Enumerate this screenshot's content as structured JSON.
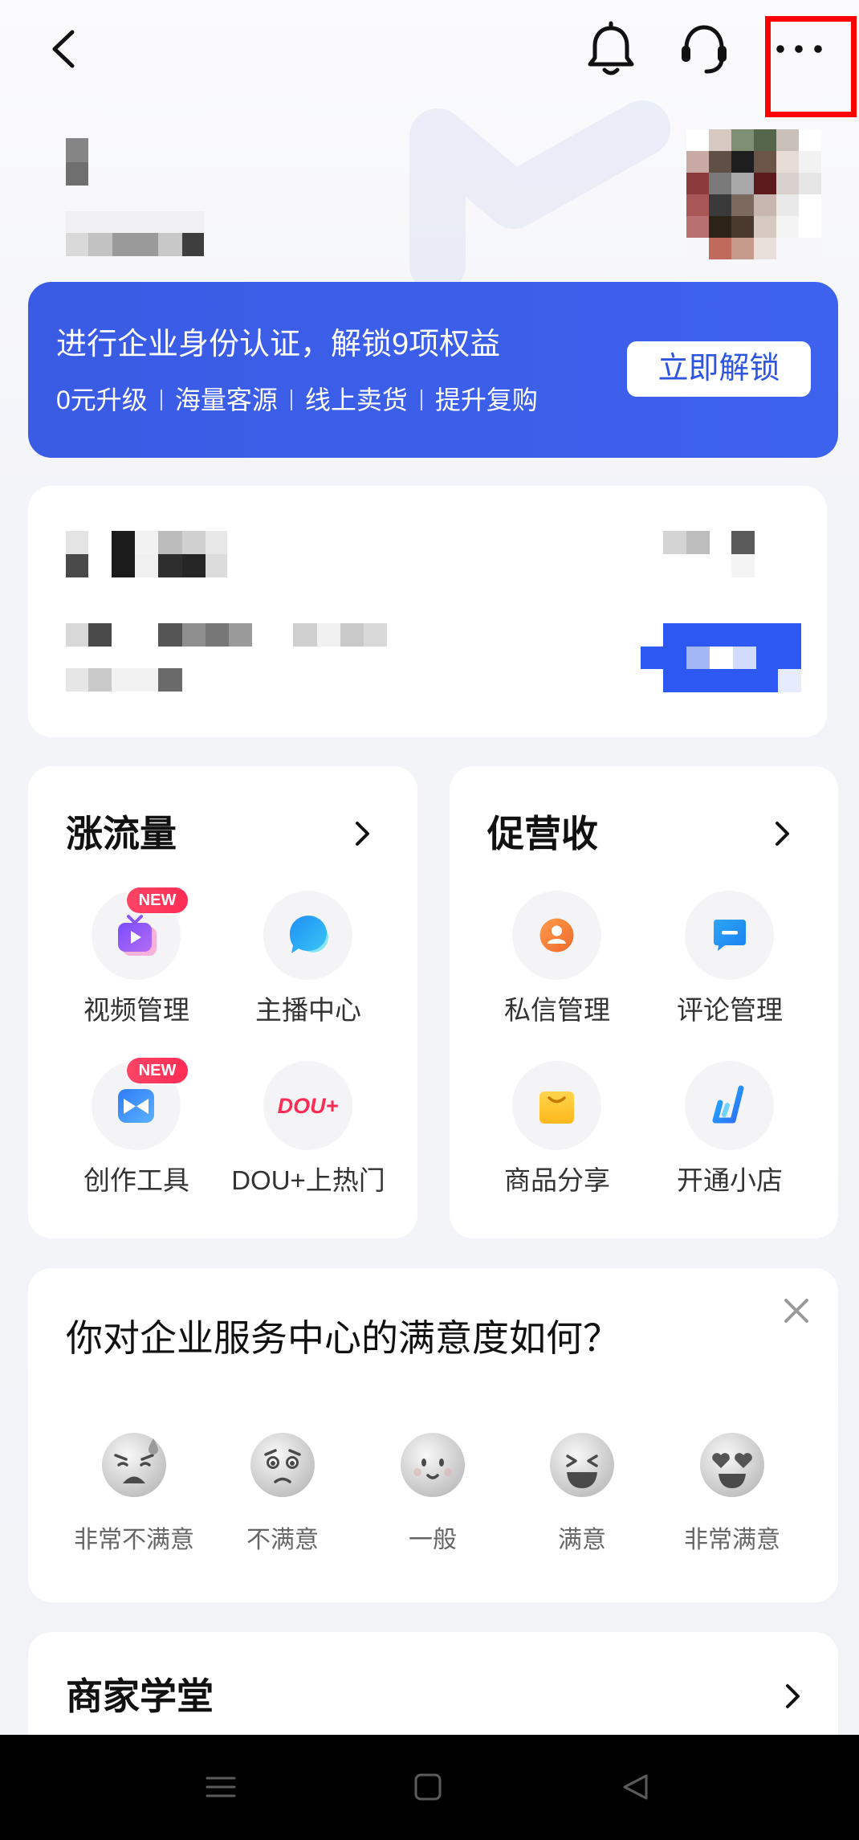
{
  "header": {
    "back_icon": "back-icon",
    "notification_icon": "bell-icon",
    "support_icon": "headset-icon",
    "more_icon": "more-icon",
    "highlight_color": "#ff0000"
  },
  "banner": {
    "title": "进行企业身份认证，解锁9项权益",
    "perks": [
      "0元升级",
      "海量客源",
      "线上卖货",
      "提升复购"
    ],
    "button_label": "立即解锁",
    "background_color": "#3c5fe9"
  },
  "traffic_section": {
    "title": "涨流量",
    "items": [
      {
        "label": "视频管理",
        "badge": "NEW",
        "icon": "video-tv-icon"
      },
      {
        "label": "主播中心",
        "icon": "streamer-bubble-icon"
      },
      {
        "label": "创作工具",
        "badge": "NEW",
        "icon": "creation-tools-icon"
      },
      {
        "label": "DOU+上热门",
        "icon": "dou-plus-icon",
        "icon_text": "DOU+"
      }
    ]
  },
  "revenue_section": {
    "title": "促营收",
    "items": [
      {
        "label": "私信管理",
        "icon": "person-icon"
      },
      {
        "label": "评论管理",
        "icon": "comment-icon"
      },
      {
        "label": "商品分享",
        "icon": "shopping-bag-icon"
      },
      {
        "label": "开通小店",
        "icon": "shop-logo-icon"
      }
    ]
  },
  "survey": {
    "title": "你对企业服务中心的满意度如何？",
    "close_icon": "close-icon",
    "options": [
      {
        "label": "非常不满意",
        "icon": "very-dissatisfied-face-icon"
      },
      {
        "label": "不满意",
        "icon": "dissatisfied-face-icon"
      },
      {
        "label": "一般",
        "icon": "neutral-face-icon"
      },
      {
        "label": "满意",
        "icon": "satisfied-face-icon"
      },
      {
        "label": "非常满意",
        "icon": "very-satisfied-face-icon"
      }
    ]
  },
  "academy": {
    "title": "商家学堂"
  },
  "system_nav": {
    "icons": [
      "menu-icon",
      "home-square-icon",
      "back-triangle-icon"
    ]
  },
  "colors": {
    "accent": "#3c5fe9",
    "badge": "#fe2c55",
    "page_background": "#f2f3f7",
    "card_background": "#ffffff"
  }
}
